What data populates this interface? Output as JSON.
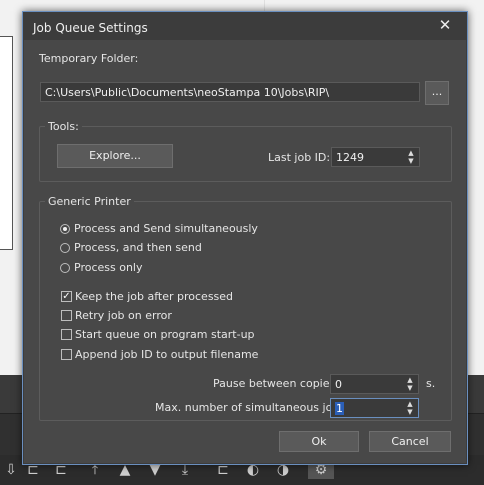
{
  "dialog": {
    "title": "Job Queue Settings",
    "close_glyph": "✕",
    "temp_folder": {
      "label": "Temporary Folder:",
      "path": "C:\\Users\\Public\\Documents\\neoStampa 10\\Jobs\\RIP\\",
      "browse_label": "..."
    },
    "tools": {
      "group_label": "Tools:",
      "explore_label": "Explore...",
      "last_job_label": "Last job ID:",
      "last_job_value": "1249"
    },
    "generic_printer": {
      "group_label": "Generic Printer",
      "radio_options": [
        {
          "label": "Process and Send simultaneously",
          "selected": true
        },
        {
          "label": "Process, and then send",
          "selected": false
        },
        {
          "label": "Process only",
          "selected": false
        }
      ],
      "checkboxes": [
        {
          "label": "Keep the job after processed",
          "checked": true
        },
        {
          "label": "Retry job on error",
          "checked": false
        },
        {
          "label": "Start queue on program start-up",
          "checked": false
        },
        {
          "label": "Append job ID to output filename",
          "checked": false
        }
      ],
      "pause_label": "Pause between copies:",
      "pause_value": "0",
      "pause_unit": "s.",
      "max_jobs_label": "Max. number of simultaneous jobs:",
      "max_jobs_value": "1"
    },
    "ok_label": "Ok",
    "cancel_label": "Cancel"
  },
  "colors": {
    "dialog_bg": "#484848",
    "title_bg": "#3c3c3c",
    "accent_border": "#6a8fbf",
    "selection": "#2b5fb8"
  }
}
